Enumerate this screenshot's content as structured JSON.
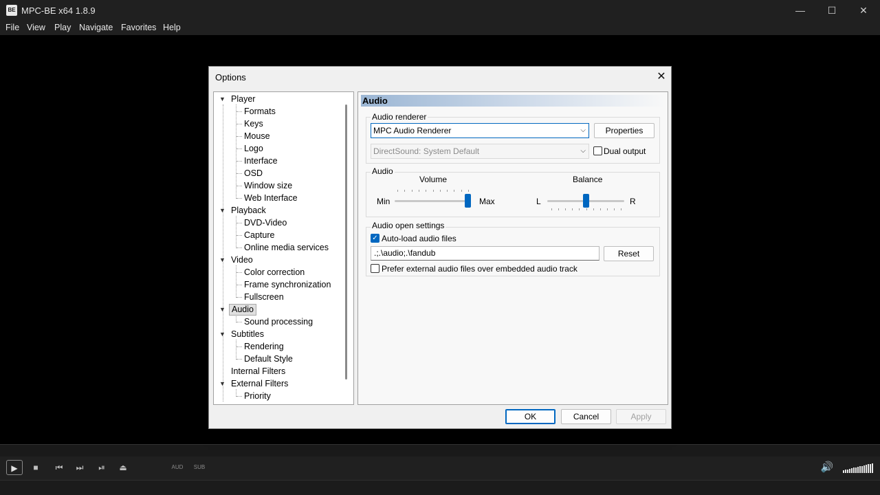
{
  "window": {
    "title": "MPC-BE x64 1.8.9",
    "icon": "BE"
  },
  "titlebar_buttons": {
    "minimize": "—",
    "maximize": "☐",
    "close": "✕"
  },
  "menu": [
    "File",
    "View",
    "Play",
    "Navigate",
    "Favorites",
    "Help"
  ],
  "controls": {
    "play": "▶",
    "stop": "■",
    "prev": "⏮",
    "next": "⏭",
    "frame_step": "⏯",
    "eject": "⏏",
    "aud": "AUD",
    "sub": "SUB",
    "volume_icon": "🔊"
  },
  "dialog": {
    "title": "Options",
    "close": "✕",
    "tree": {
      "player": "Player",
      "player_children": [
        "Formats",
        "Keys",
        "Mouse",
        "Logo",
        "Interface",
        "OSD",
        "Window size",
        "Web Interface"
      ],
      "playback": "Playback",
      "playback_children": [
        "DVD-Video",
        "Capture",
        "Online media services"
      ],
      "video": "Video",
      "video_children": [
        "Color correction",
        "Frame synchronization",
        "Fullscreen"
      ],
      "audio": "Audio",
      "audio_children": [
        "Sound processing"
      ],
      "subtitles": "Subtitles",
      "subtitles_children": [
        "Rendering",
        "Default Style"
      ],
      "internal_filters": "Internal Filters",
      "external_filters": "External Filters",
      "external_filters_children": [
        "Priority"
      ]
    },
    "page": {
      "header": "Audio",
      "renderer_group": {
        "label": "Audio renderer",
        "renderer_value": "MPC Audio Renderer",
        "properties_button": "Properties",
        "device_value": "DirectSound: System Default",
        "dual_output_label": "Dual output",
        "dual_output_checked": false
      },
      "audio_group": {
        "label": "Audio",
        "volume_label": "Volume",
        "volume_min": "Min",
        "volume_max": "Max",
        "volume_level": 1.0,
        "balance_label": "Balance",
        "balance_left": "L",
        "balance_right": "R",
        "balance_level": 0.5
      },
      "open_group": {
        "label": "Audio open settings",
        "autoload_label": "Auto-load audio files",
        "autoload_checked": true,
        "paths_value": ".;.\\audio;.\\fandub",
        "reset_button": "Reset",
        "prefer_external_label": "Prefer external audio files over embedded audio track",
        "prefer_external_checked": false
      }
    },
    "buttons": {
      "ok": "OK",
      "cancel": "Cancel",
      "apply": "Apply"
    }
  }
}
